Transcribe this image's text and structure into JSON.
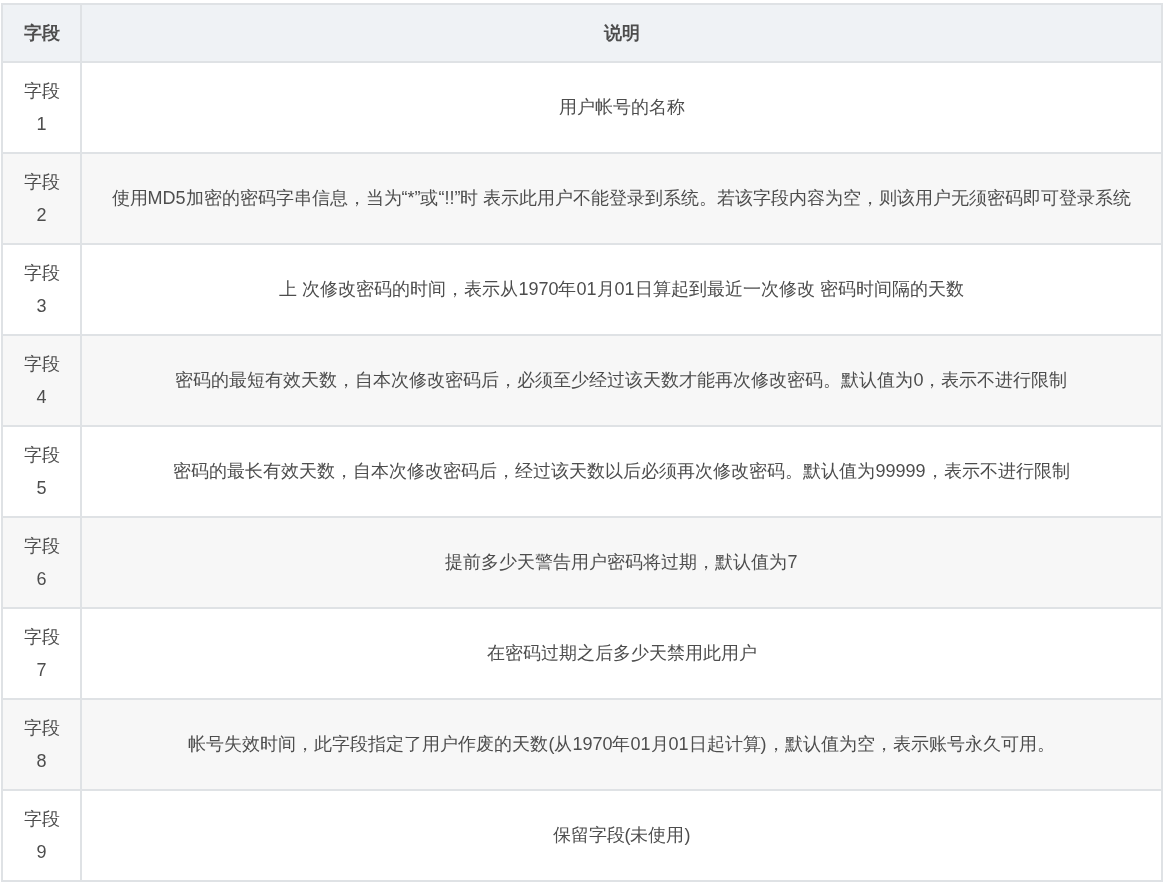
{
  "table": {
    "columns": [
      "字段",
      "说明"
    ],
    "rows": [
      {
        "field": "字段1",
        "description": "用户帐号的名称"
      },
      {
        "field": "字段2",
        "description": "使用MD5加密的密码字串信息，当为“*”或“!!”时 表示此用户不能登录到系统。若该字段内容为空，则该用户无须密码即可登录系统"
      },
      {
        "field": "字段3",
        "description": "上 次修改密码的时间，表示从1970年01月01日算起到最近一次修改 密码时间隔的天数"
      },
      {
        "field": "字段4",
        "description": "密码的最短有效天数，自本次修改密码后，必须至少经过该天数才能再次修改密码。默认值为0，表示不进行限制"
      },
      {
        "field": "字段5",
        "description": "密码的最长有效天数，自本次修改密码后，经过该天数以后必须再次修改密码。默认值为99999，表示不进行限制"
      },
      {
        "field": "字段6",
        "description": "提前多少天警告用户密码将过期，默认值为7"
      },
      {
        "field": "字段7",
        "description": "在密码过期之后多少天禁用此用户"
      },
      {
        "field": "字段8",
        "description": "帐号失效时间，此字段指定了用户作废的天数(从1970年01月01日起计算)，默认值为空，表示账号永久可用。"
      },
      {
        "field": "字段9",
        "description": "保留字段(未使用)"
      }
    ]
  }
}
